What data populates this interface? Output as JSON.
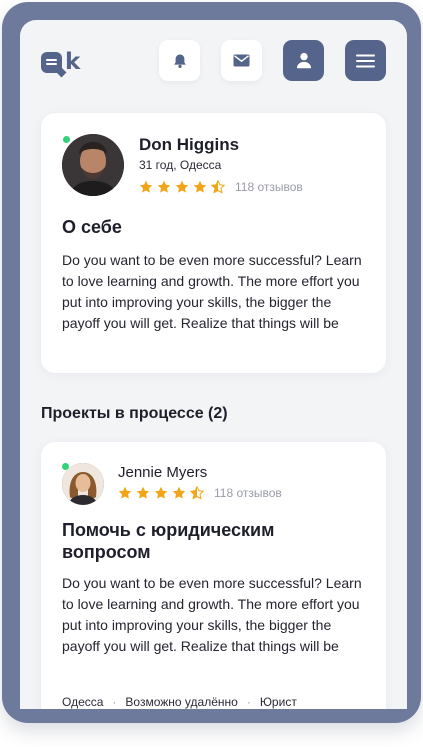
{
  "header": {
    "logo_text": "k",
    "icons": [
      "logo-chat-icon",
      "bell-icon",
      "mail-icon",
      "user-icon",
      "menu-icon"
    ]
  },
  "profile": {
    "name": "Don Higgins",
    "meta": "31 год, Одесса",
    "rating": 4.5,
    "reviews": "118 отзывов",
    "online": true,
    "about_title": "О себе",
    "about_text": "Do you want to be even more successful? Learn to love learning and growth. The more effort you put into improving your skills, the bigger the payoff you will get. Realize that things will be"
  },
  "projects": {
    "heading": "Проекты в процессе (2)",
    "items": [
      {
        "client_name": "Jennie Myers",
        "rating": 4.5,
        "reviews": "118 отзывов",
        "online": true,
        "title": "Помочь с юридическим вопросом",
        "description": "Do you want to be even more successful? Learn to love learning and growth. The more effort you put into improving your skills, the bigger the payoff you will get. Realize that things will be",
        "tags": [
          "Одесса",
          "Возможно удалённо",
          "Юрист"
        ]
      }
    ]
  },
  "colors": {
    "frame": "#6e7a9c",
    "accent": "#55648a",
    "star": "#f2a516",
    "online": "#33d17a",
    "background": "#f3f4f6"
  }
}
